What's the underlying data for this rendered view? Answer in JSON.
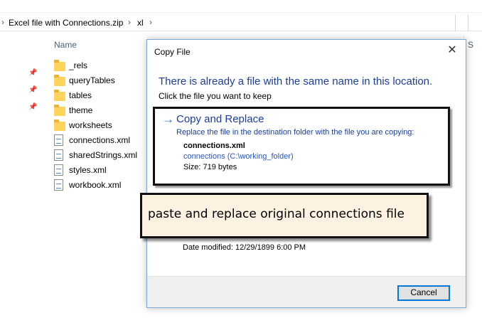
{
  "explorer": {
    "breadcrumb": [
      "Excel file with Connections.zip",
      "xl"
    ],
    "breadcrumb_separator": "›",
    "column_name": "Name",
    "column_s": "S",
    "files": [
      {
        "name": "_rels",
        "type": "folder"
      },
      {
        "name": "queryTables",
        "type": "folder"
      },
      {
        "name": "tables",
        "type": "folder"
      },
      {
        "name": "theme",
        "type": "folder"
      },
      {
        "name": "worksheets",
        "type": "folder"
      },
      {
        "name": "connections.xml",
        "type": "xml"
      },
      {
        "name": "sharedStrings.xml",
        "type": "xml"
      },
      {
        "name": "styles.xml",
        "type": "xml"
      },
      {
        "name": "workbook.xml",
        "type": "xml"
      }
    ],
    "pin_icon": "pin-icon"
  },
  "dialog": {
    "title": "Copy File",
    "close_symbol": "✕",
    "heading": "There is already a file with the same name in this location.",
    "subheading": "Click the file you want to keep",
    "option": {
      "arrow": "→",
      "title": "Copy and Replace",
      "description": "Replace the file in the destination folder with the file you are copying:",
      "file_name": "connections.xml",
      "location": "connections (C:\\working_folder)",
      "size": "Size: 719 bytes"
    },
    "date_modified": "Date modified: 12/29/1899 6:00 PM",
    "cancel_label": "Cancel"
  },
  "callout": {
    "text": "paste and replace original connections file"
  },
  "colors": {
    "accent_blue": "#1a3d9e",
    "link_blue": "#2a55b5",
    "callout_bg": "#fdf1e1"
  }
}
